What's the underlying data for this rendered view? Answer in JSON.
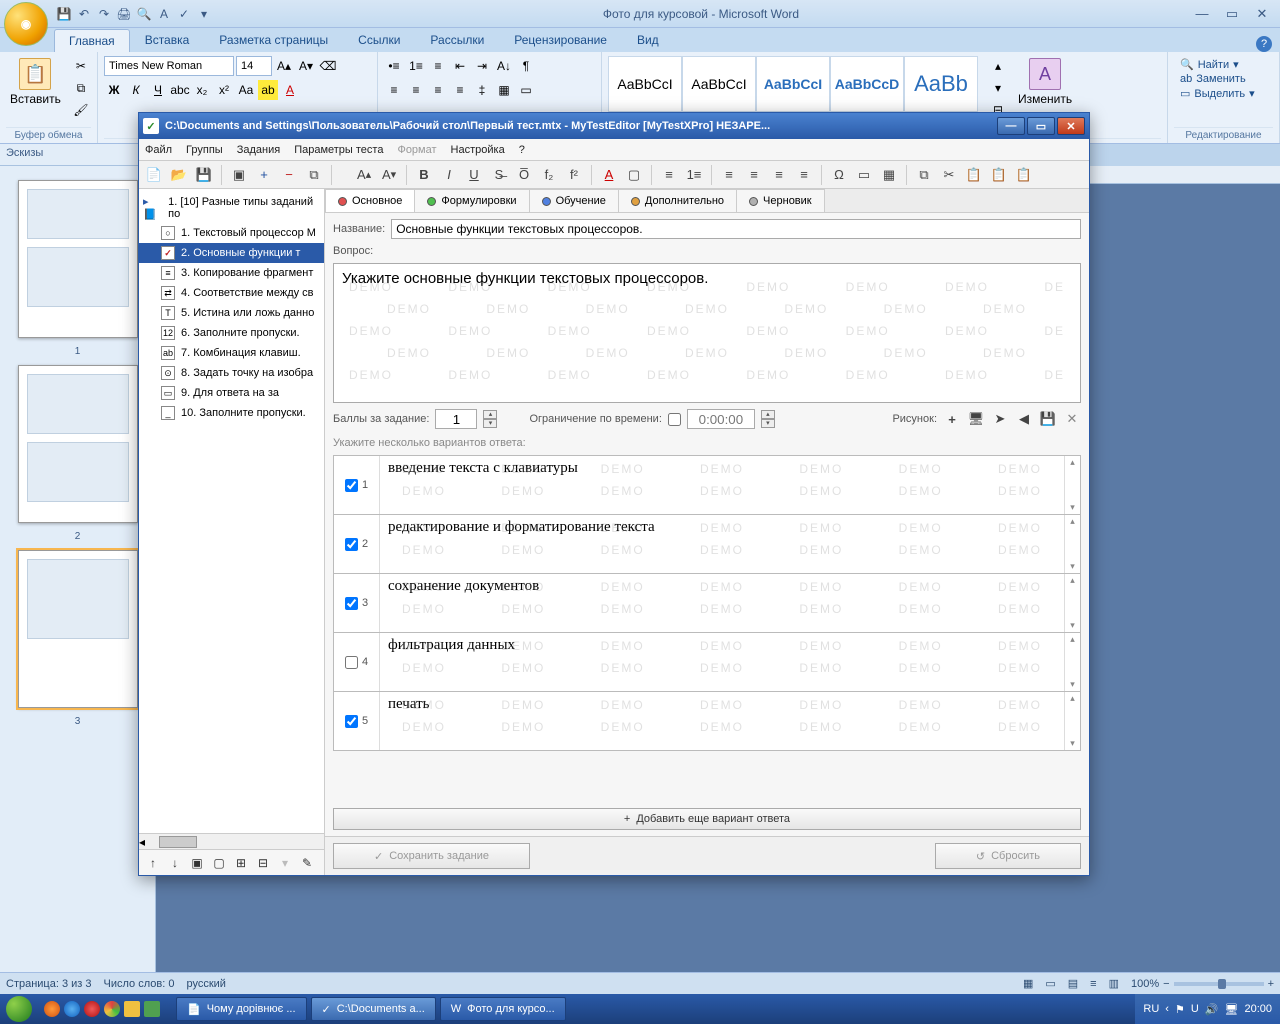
{
  "word": {
    "title": "Фото для курсовой - Microsoft Word",
    "tabs": [
      "Главная",
      "Вставка",
      "Разметка страницы",
      "Ссылки",
      "Рассылки",
      "Рецензирование",
      "Вид"
    ],
    "clipboard": {
      "paste": "Вставить",
      "label": "Буфер обмена"
    },
    "font": {
      "name": "Times New Roman",
      "size": "14",
      "label": ""
    },
    "styles": {
      "change": "Изменить",
      "preview": "AaBbCcI",
      "preview2": "AaBbCcD",
      "preview3": "AaBb"
    },
    "editing": {
      "find": "Найти",
      "replace": "Заменить",
      "select": "Выделить",
      "label": "Редактирование"
    },
    "thumbs_header": "Эскизы",
    "thumbs": [
      "1",
      "2",
      "3"
    ],
    "status": {
      "page": "Страница: 3 из 3",
      "words": "Число слов: 0",
      "lang": "русский",
      "zoom": "100%"
    }
  },
  "editor": {
    "title": "C:\\Documents and Settings\\Пользователь\\Рабочий стол\\Первый тест.mtx - MyTestEditor [MyTestXPro] НЕЗАРЕ...",
    "menu": [
      "Файл",
      "Группы",
      "Задания",
      "Параметры теста",
      "Формат",
      "Настройка",
      "?"
    ],
    "menu_disabled": [
      4
    ],
    "tree_root": "1. [10] Разные типы заданий по",
    "tree": [
      "1. Текстовый процессор M",
      "2. Основные функции т",
      "3. Копирование фрагмент",
      "4. Соответствие между св",
      "5. Истина или ложь данно",
      "6. Заполните пропуски.",
      "7. Комбинация клавиш.",
      "8. Задать точку на изобра",
      "9. Для ответа на за",
      "10. Заполните пропуски."
    ],
    "tree_selected": 1,
    "tabs": [
      {
        "label": "Основное",
        "color": "red"
      },
      {
        "label": "Формулировки",
        "color": "green"
      },
      {
        "label": "Обучение",
        "color": "blue"
      },
      {
        "label": "Дополнительно",
        "color": "orange"
      },
      {
        "label": "Черновик",
        "color": "gray"
      }
    ],
    "name_label": "Название:",
    "name_value": "Основные функции текстовых процессоров.",
    "question_label": "Вопрос:",
    "question_text": "Укажите основные функции текстовых процессоров.",
    "points_label": "Баллы за задание:",
    "points_value": "1",
    "timelimit_label": "Ограничение по времени:",
    "timelimit_value": "0:00:00",
    "picture_label": "Рисунок:",
    "answers_hint": "Укажите несколько вариантов ответа:",
    "answers": [
      {
        "n": "1",
        "text": "введение текста с клавиатуры",
        "checked": true
      },
      {
        "n": "2",
        "text": "редактирование и форматирование текста",
        "checked": true
      },
      {
        "n": "3",
        "text": "сохранение документов",
        "checked": true
      },
      {
        "n": "4",
        "text": "фильтрация данных",
        "checked": false
      },
      {
        "n": "5",
        "text": "печать",
        "checked": true
      }
    ],
    "add_answer": "Добавить еще вариант ответа",
    "save_btn": "Сохранить задание",
    "reset_btn": "Сбросить"
  },
  "taskbar": {
    "items": [
      "Чому дорівнює ...",
      "C:\\Documents a...",
      "Фото для курсо..."
    ],
    "lang": "RU",
    "time": "20:00"
  }
}
